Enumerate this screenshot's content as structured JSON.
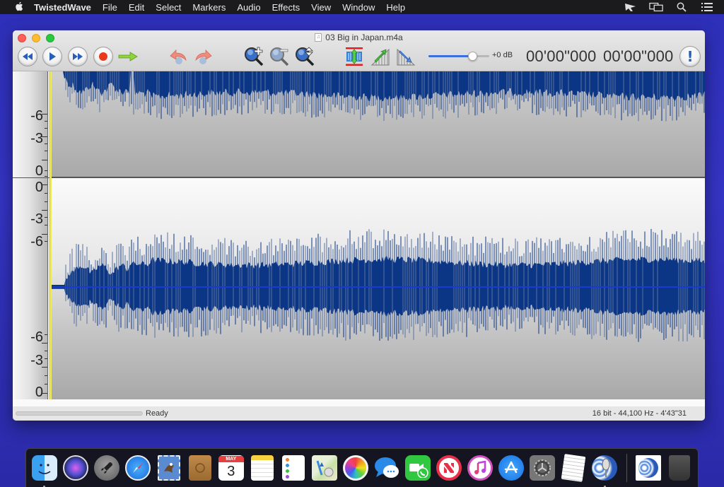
{
  "menubar": {
    "apple": "",
    "app_name": "TwistedWave",
    "items": [
      "File",
      "Edit",
      "Select",
      "Markers",
      "Audio",
      "Effects",
      "View",
      "Window",
      "Help"
    ],
    "status_icons": [
      "scissors-cursor-icon",
      "display-mirror-icon",
      "spotlight-search-icon",
      "notification-center-icon"
    ]
  },
  "window": {
    "title": "03 Big in Japan.m4a",
    "toolbar": {
      "buttons": [
        "rewind",
        "play",
        "fast-forward",
        "record",
        "go-to",
        "undo",
        "redo",
        "zoom-in",
        "zoom-out",
        "zoom-fit",
        "normalize",
        "fade-in",
        "fade-out"
      ],
      "gain": {
        "value_fraction": 0.72,
        "label": "+0 dB"
      },
      "time_start": "00'00\"000",
      "time_end": "00'00\"000",
      "alert_label": "!"
    },
    "ruler": {
      "channel1": [
        "-6",
        "-3",
        "0"
      ],
      "channel2_top": [
        "0",
        "-3",
        "-6"
      ],
      "channel2_bottom": [
        "-6",
        "-3",
        "0"
      ]
    },
    "status": {
      "text": "Ready",
      "format": "16 bit - 44,100 Hz - 4'43\"31",
      "progress_fraction": 0
    },
    "colors": {
      "waveform": "#0b3585",
      "playhead": "#f2ec5a"
    }
  },
  "dock": {
    "items": [
      "Finder",
      "Siri",
      "Launchpad",
      "Safari",
      "Mail",
      "Contacts",
      "Calendar",
      "Notes",
      "Reminders",
      "Maps",
      "Photos",
      "Messages",
      "FaceTime",
      "News",
      "iTunes",
      "App Store",
      "System Preferences",
      "TextEdit",
      "TwistedWave"
    ],
    "calendar_month": "MAY",
    "calendar_day": "3",
    "extra_items": [
      "TwistedWave Document",
      "Trash"
    ]
  }
}
